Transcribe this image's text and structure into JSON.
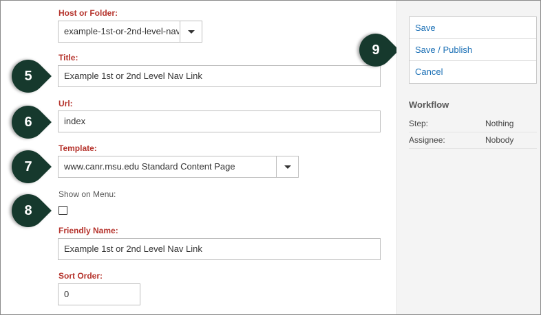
{
  "form": {
    "host_folder": {
      "label": "Host or Folder:",
      "value": "example-1st-or-2nd-level-nav"
    },
    "title": {
      "label": "Title:",
      "value": "Example 1st or 2nd Level Nav Link"
    },
    "url": {
      "label": "Url:",
      "value": "index"
    },
    "template": {
      "label": "Template:",
      "value": "www.canr.msu.edu Standard Content Page"
    },
    "show_on_menu": {
      "label": "Show on Menu:",
      "checked": false
    },
    "friendly_name": {
      "label": "Friendly Name:",
      "value": "Example 1st or 2nd Level Nav Link"
    },
    "sort_order": {
      "label": "Sort Order:",
      "value": "0"
    }
  },
  "callouts": [
    "5",
    "6",
    "7",
    "8",
    "9"
  ],
  "sidebar": {
    "actions": [
      "Save",
      "Save / Publish",
      "Cancel"
    ],
    "workflow": {
      "title": "Workflow",
      "rows": [
        {
          "key": "Step:",
          "value": "Nothing"
        },
        {
          "key": "Assignee:",
          "value": "Nobody"
        }
      ]
    }
  },
  "colors": {
    "label_red": "#b5322b",
    "link_blue": "#1a6fb5",
    "callout_green": "#16392d",
    "sidebar_bg": "#f4f4f4"
  }
}
